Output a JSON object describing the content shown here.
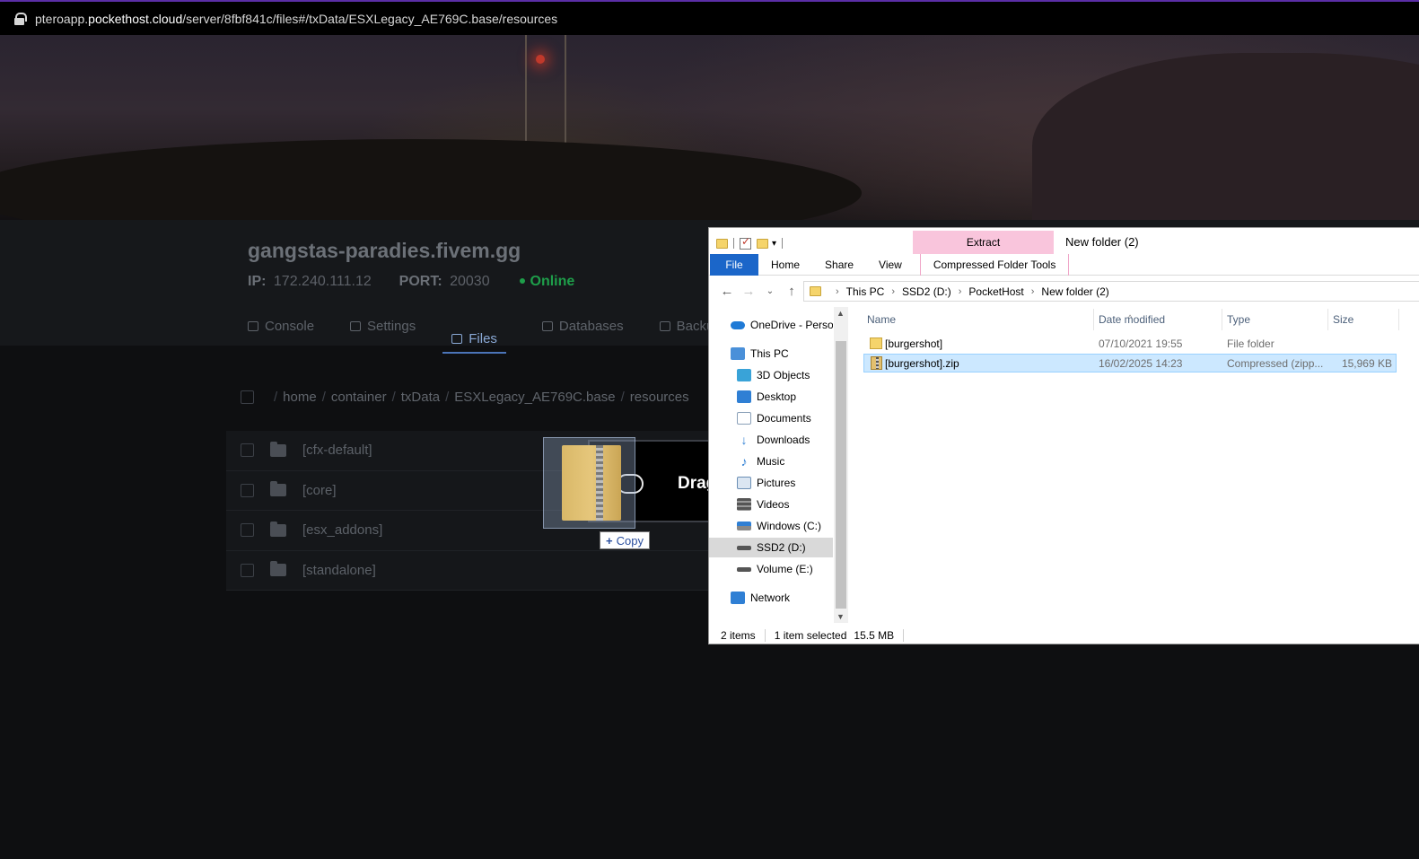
{
  "browser": {
    "url_prefix": "pteroapp.",
    "url_host": "pockethost.cloud",
    "url_path": "/server/8fbf841c/files#/txData/ESXLegacy_AE769C.base/resources"
  },
  "server": {
    "name": "gangstas-paradies.fivem.gg",
    "ip_label": "IP:",
    "ip": "172.240.111.12",
    "port_label": "PORT:",
    "port": "20030",
    "status": "Online"
  },
  "tabs": [
    {
      "label": "Console",
      "icon": "terminal-icon"
    },
    {
      "label": "Settings",
      "icon": "settings-lines-icon"
    },
    {
      "label": "Files",
      "icon": "folder-icon"
    },
    {
      "label": "Databases",
      "icon": "database-icon"
    },
    {
      "label": "Backup",
      "icon": "cloud-icon"
    }
  ],
  "breadcrumb": [
    "home",
    "container",
    "txData",
    "ESXLegacy_AE769C.base",
    "resources"
  ],
  "files": [
    "[cfx-default]",
    "[core]",
    "[esx_addons]",
    "[standalone]"
  ],
  "drop_text": "Drag",
  "copy_tooltip": {
    "plus": "+",
    "label": "Copy"
  },
  "explorer": {
    "context_tab": "Extract",
    "window_title": "New folder (2)",
    "ribbon": [
      "File",
      "Home",
      "Share",
      "View",
      "Compressed Folder Tools"
    ],
    "path": [
      "This PC",
      "SSD2 (D:)",
      "PocketHost",
      "New folder (2)"
    ],
    "nav": [
      {
        "label": "OneDrive - Person",
        "icon": "onedrive-cloud-icon",
        "color": "#1f7ad6"
      },
      {
        "label": "This PC",
        "icon": "computer-icon",
        "color": "#4a90d9"
      },
      {
        "label": "3D Objects",
        "icon": "cube-icon",
        "color": "#39a3d8"
      },
      {
        "label": "Desktop",
        "icon": "desktop-icon",
        "color": "#2f7fd4"
      },
      {
        "label": "Documents",
        "icon": "documents-icon",
        "color": "#8aa0b8"
      },
      {
        "label": "Downloads",
        "icon": "download-arrow-icon",
        "color": "#2f7fd4"
      },
      {
        "label": "Music",
        "icon": "music-note-icon",
        "color": "#2f7fd4"
      },
      {
        "label": "Pictures",
        "icon": "pictures-icon",
        "color": "#6b8fb5"
      },
      {
        "label": "Videos",
        "icon": "film-icon",
        "color": "#555"
      },
      {
        "label": "Windows (C:)",
        "icon": "windows-drive-icon",
        "color": "#777"
      },
      {
        "label": "SSD2 (D:)",
        "icon": "drive-icon",
        "color": "#555"
      },
      {
        "label": "Volume (E:)",
        "icon": "drive-icon",
        "color": "#555"
      },
      {
        "label": "Network",
        "icon": "network-icon",
        "color": "#2f7fd4"
      }
    ],
    "columns": [
      "Name",
      "Date modified",
      "Type",
      "Size"
    ],
    "rows": [
      {
        "name": "[burgershot]",
        "date": "07/10/2021 19:55",
        "type": "File folder",
        "size": ""
      },
      {
        "name": "[burgershot].zip",
        "date": "16/02/2025 14:23",
        "type": "Compressed (zipp...",
        "size": "15,969 KB"
      }
    ],
    "status": {
      "count": "2 items",
      "selected": "1 item selected",
      "size": "15.5 MB"
    }
  }
}
